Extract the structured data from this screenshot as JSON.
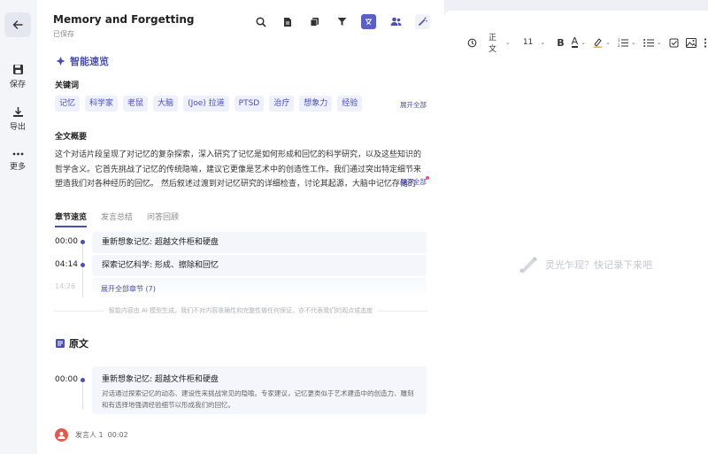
{
  "rail": {
    "save_label": "保存",
    "export_label": "导出",
    "more_label": "更多"
  },
  "doc": {
    "title": "Memory and Forgetting",
    "status": "已保存"
  },
  "smart": {
    "heading": "智能速览",
    "keywords_label": "关键词",
    "keywords": [
      "记忆",
      "科学家",
      "老鼠",
      "大脑",
      "(Joe) 拉道",
      "PTSD",
      "治疗",
      "想象力",
      "经验"
    ],
    "expand_all": "展开全部",
    "summary_label": "全文概要",
    "summary": "这个对话片段呈现了对记忆的复杂探索，深入研究了记忆是如何形成和回忆的科学研究，以及这些知识的哲学含义。它首先挑战了记忆的传统隐喻，建议它更像是艺术中的创造性工作。我们通过突出特定细节来塑造我们对各种经历的回忆。 然后叙述过渡到对记忆研究的详细检查，讨论其起源，大脑中记忆存储的生...",
    "summary_expand": "展开全部"
  },
  "tabs": [
    "章节速览",
    "发言总结",
    "问答回顾"
  ],
  "chapters": [
    {
      "time": "00:00",
      "title": "重新想象记忆: 超越文件柜和硬盘"
    },
    {
      "time": "04:14",
      "title": "探索记忆科学: 形成、擦除和回忆"
    }
  ],
  "chapter_faded_time": "14:26",
  "more_chapters": "展开全部章节 (7)",
  "ai_note": "智能内容由 AI 模型生成，我们不对内容准确性和完整性做任何保证，亦不代表我们的观点或态度",
  "original": {
    "heading": "原文",
    "time": "00:00",
    "title": "重新想象记忆: 超越文件柜和硬盘",
    "body": "对话通过探索记忆的动态、建设性来挑战常见的隐喻。专家建议，记忆更类似于艺术建造中的创造力、雕刻和有选择地强调经验细节以形成我们的回忆。"
  },
  "speaker": {
    "name": "发言人 1",
    "time": "00:02"
  },
  "editor": {
    "style": "正文",
    "size": "11",
    "placeholder": "灵光乍现？快记录下来吧"
  },
  "colors": {
    "accent": "#4a4fb3",
    "chip_bg": "#eef0fb"
  }
}
